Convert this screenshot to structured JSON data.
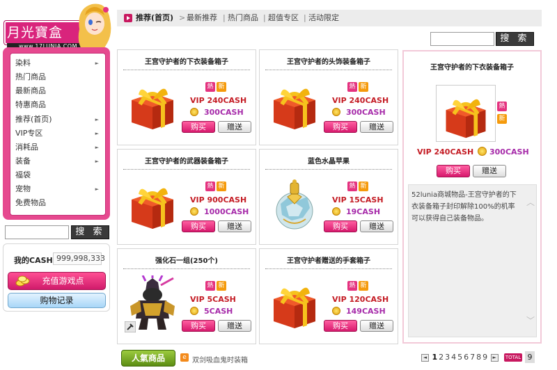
{
  "logo": {
    "title": "月光寶盒",
    "url": "www.17LUNIA.COM"
  },
  "sidebar": {
    "items": [
      {
        "label": "染料",
        "has_arrow": true,
        "arrow": "►"
      },
      {
        "label": "热门商品",
        "has_arrow": false
      },
      {
        "label": "最新商品",
        "has_arrow": false
      },
      {
        "label": "特惠商品",
        "has_arrow": false
      },
      {
        "label": "推荐(首页)",
        "has_arrow": true,
        "arrow": "►"
      },
      {
        "label": "VIP专区",
        "has_arrow": true,
        "arrow": "►"
      },
      {
        "label": "消耗品",
        "has_arrow": true,
        "arrow": "►"
      },
      {
        "label": "装备",
        "has_arrow": true,
        "arrow": "►"
      },
      {
        "label": "福袋",
        "has_arrow": false
      },
      {
        "label": "宠物",
        "has_arrow": true,
        "arrow": "►"
      },
      {
        "label": "免费物品",
        "has_arrow": false
      }
    ]
  },
  "search": {
    "button_label": "搜 索",
    "value": ""
  },
  "cash": {
    "label": "我的CASH",
    "value": "999,998,333",
    "recharge_label": "充值游戏点",
    "history_label": "购物记录"
  },
  "nav": {
    "current": "推荐(首页)",
    "arrow": ">",
    "links": [
      "最新推荐",
      "热门商品",
      "超值专区",
      "活动限定"
    ],
    "separator": "|"
  },
  "tags": {
    "hot": "熱",
    "new": "新"
  },
  "buttons": {
    "buy": "购买",
    "gift": "赠送"
  },
  "products": [
    {
      "title": "王宫守护者的下衣装备箱子",
      "vip": "VIP 240CASH",
      "price": "300CASH",
      "image": "gift-box"
    },
    {
      "title": "王宫守护者的头饰装备箱子",
      "vip": "VIP 240CASH",
      "price": "300CASH",
      "image": "gift-box"
    },
    {
      "title": "王宫守护者的武器装备箱子",
      "vip": "VIP 900CASH",
      "price": "1000CASH",
      "image": "gift-box"
    },
    {
      "title": "蓝色水晶苹果",
      "vip": "VIP 15CASH",
      "price": "19CASH",
      "image": "crystal-apple"
    },
    {
      "title": "强化石一组(250个)",
      "vip": "VIP 5CASH",
      "price": "5CASH",
      "image": "armored-character"
    },
    {
      "title": "王宫守护者赠送的手套箱子",
      "vip": "VIP 120CASH",
      "price": "149CASH",
      "image": "gift-box"
    }
  ],
  "detail": {
    "title": "王宫守护者的下衣装备箱子",
    "vip": "VIP 240CASH",
    "price": "300CASH",
    "description": "52lunia商城物品-王宫守护者的下衣装备箱子封印解除100%的机率可以获得自己装备物品。"
  },
  "footer": {
    "popular_label": "人氣商品",
    "ad_icon": "e",
    "ad_text": "双剑吸血鬼时装箱",
    "pages": [
      "1",
      "2",
      "3",
      "4",
      "5",
      "6",
      "7",
      "8",
      "9"
    ],
    "current_page": "1",
    "total_label": "TOTAL",
    "total_value": "9"
  },
  "colors": {
    "accent": "#e6498f",
    "vip_red": "#c41c24",
    "price_purple": "#a62aa9",
    "popular_green": "#6e9c1e"
  }
}
